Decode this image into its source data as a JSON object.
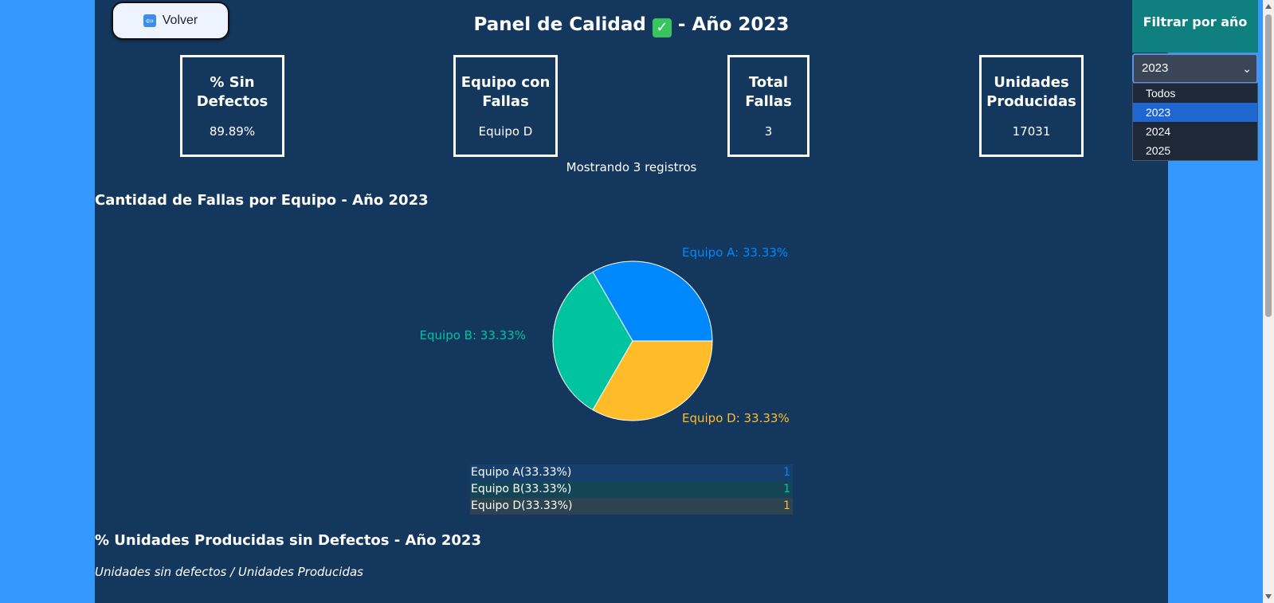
{
  "header": {
    "back_label": "Volver",
    "back_icon": "back-arrow-icon",
    "title_part1": "Panel de Calidad",
    "title_icon": "check-icon",
    "title_part2": "- Año 2023"
  },
  "kpis": [
    {
      "label": "% Sin Defectos",
      "value": "89.89%"
    },
    {
      "label": "Equipo con Fallas",
      "value": "Equipo D"
    },
    {
      "label": "Total Fallas",
      "value": "3"
    },
    {
      "label": "Unidades Producidas",
      "value": "17031"
    }
  ],
  "records_text": "Mostrando 3 registros",
  "pie_section": {
    "title": "Cantidad de Fallas por Equipo - Año 2023"
  },
  "chart_data": {
    "type": "pie",
    "categories": [
      "Equipo A",
      "Equipo B",
      "Equipo D"
    ],
    "values": [
      1,
      1,
      1
    ],
    "percent_labels": [
      "Equipo A: 33.33%",
      "Equipo B: 33.33%",
      "Equipo D: 33.33%"
    ],
    "colors": [
      "#0088fe",
      "#00c49f",
      "#ffbb28"
    ]
  },
  "legend_rows": [
    {
      "label": "Equipo A(33.33%)",
      "value": "1",
      "color": "#0088fe",
      "bg": "#163f6b"
    },
    {
      "label": "Equipo B(33.33%)",
      "value": "1",
      "color": "#00c49f",
      "bg": "#144556"
    },
    {
      "label": "Equipo D(33.33%)",
      "value": "1",
      "color": "#ffbb28",
      "bg": "#2d4450"
    }
  ],
  "defects_section": {
    "title": "% Unidades Producidas sin Defectos - Año 2023",
    "formula": "Unidades sin defectos / Unidades Producidas"
  },
  "filter": {
    "title": "Filtrar por año",
    "selected": "2023",
    "options": [
      "Todos",
      "2023",
      "2024",
      "2025"
    ]
  },
  "colors": {
    "page_bg": "#3399ff",
    "panel_bg": "#14375e",
    "filter_bg": "#0f7f7f"
  }
}
